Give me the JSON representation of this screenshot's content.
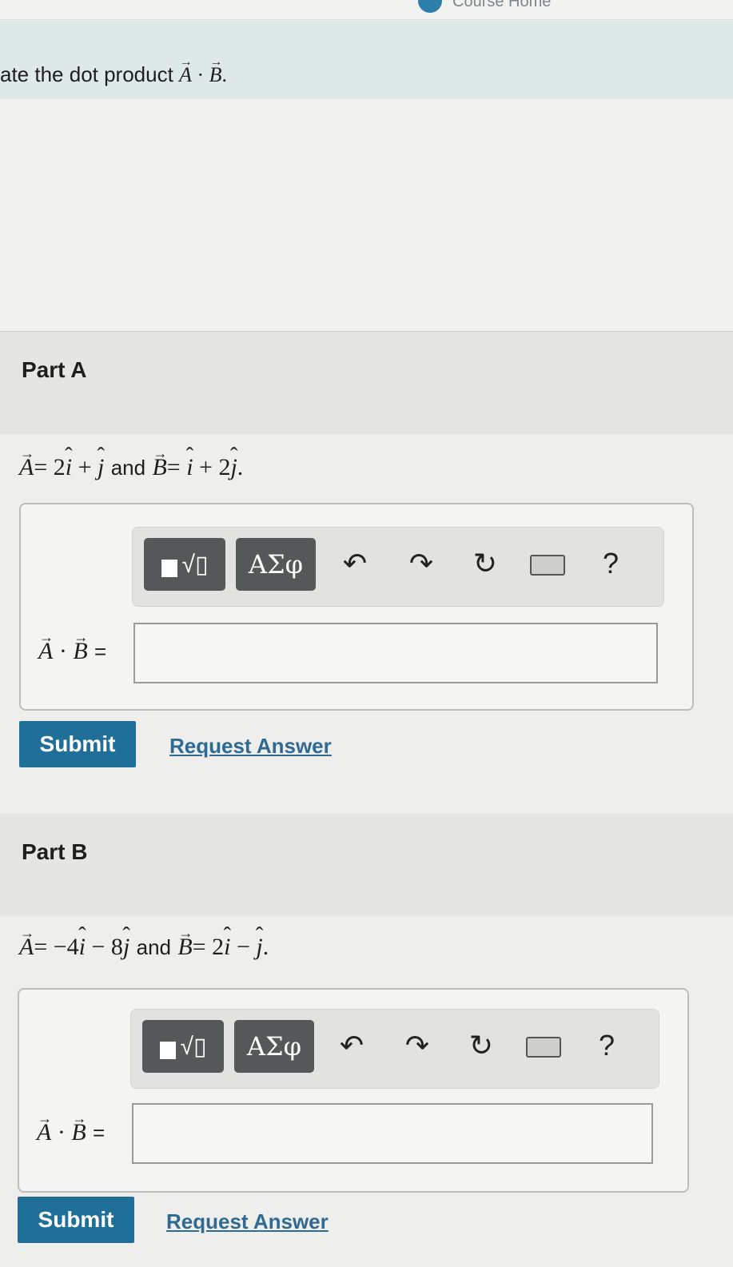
{
  "header": {
    "course_home_link": "Course Home"
  },
  "problem": {
    "prompt_text": "ate the dot product"
  },
  "parts": [
    {
      "title": "Part A",
      "and_text": "and",
      "vector_a": {
        "label": "A",
        "terms": [
          "= 2",
          "i",
          " + ",
          "j"
        ]
      },
      "vector_b": {
        "label": "B",
        "terms": [
          "= ",
          "i",
          " + 2",
          "j"
        ]
      },
      "answer_label_eq": "=",
      "answer_value": "",
      "submit_label": "Submit",
      "request_answer_label": "Request Answer"
    },
    {
      "title": "Part B",
      "and_text": "and",
      "vector_a": {
        "label": "A",
        "terms": [
          "= −4",
          "i",
          " − 8",
          "j"
        ]
      },
      "vector_b": {
        "label": "B",
        "terms": [
          "= 2",
          "i",
          " − ",
          "j"
        ]
      },
      "answer_label_eq": "=",
      "answer_value": "",
      "submit_label": "Submit",
      "request_answer_label": "Request Answer"
    }
  ],
  "toolbar": {
    "template_glyph": "√▯",
    "greek_label": "AΣφ",
    "undo_glyph": "↶",
    "redo_glyph": "↷",
    "reset_glyph": "↻",
    "help_label": "?"
  }
}
